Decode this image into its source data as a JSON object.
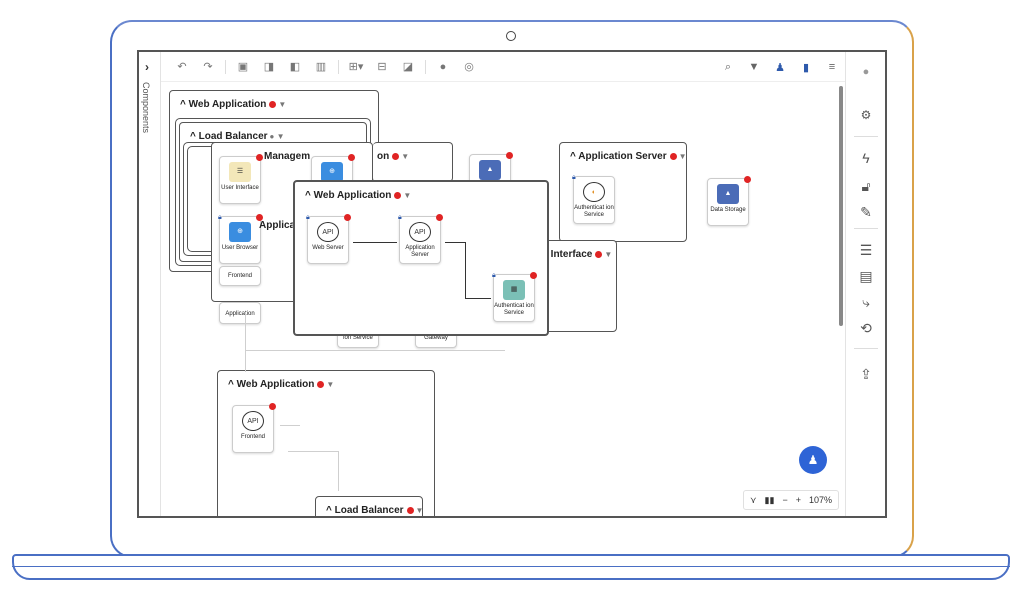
{
  "left_panel": {
    "label": "Components"
  },
  "toolbar": {
    "icons": [
      "undo-icon",
      "redo-icon",
      "copy-icon",
      "paste-icon",
      "duplicate-icon",
      "delete-icon",
      "layout-icon",
      "align-icon",
      "group-icon",
      "link-icon",
      "settings-icon"
    ],
    "right_icons": [
      "search-icon",
      "filter-icon",
      "add-user-icon",
      "document-icon",
      "menu-icon"
    ]
  },
  "groups": {
    "outer_web_app": {
      "title": "Web Application"
    },
    "load_balancer_top": {
      "title": "Load Balancer"
    },
    "management": {
      "title": "Managem"
    },
    "application_front": {
      "title": "Applicatio"
    },
    "on_partial": {
      "title": "on"
    },
    "app_server": {
      "title": "Application Server"
    },
    "user_interface": {
      "title": "r Interface"
    },
    "web_app_front": {
      "title": "Web Application"
    },
    "web_app_lower": {
      "title": "Web Application"
    },
    "load_balancer_bottom": {
      "title": "Load Balancer"
    }
  },
  "nodes": {
    "user_interface": "User Interface",
    "user_browser": "User Browser",
    "frontend": "Frontend",
    "application": "Application",
    "web_server": "Web Server",
    "application_server": "Application Server",
    "auth_service": "Authenticat ion Service",
    "auth_service_right": "Authenticat ion Service",
    "data_storage": "Data Storage",
    "ion_service": "ion Service",
    "gateway": "Gateway",
    "frontend_lower": "Frontend",
    "api_label": "API"
  },
  "zoom": {
    "value": "107%"
  },
  "colors": {
    "accent": "#2e64d6",
    "alert": "#e02424"
  }
}
